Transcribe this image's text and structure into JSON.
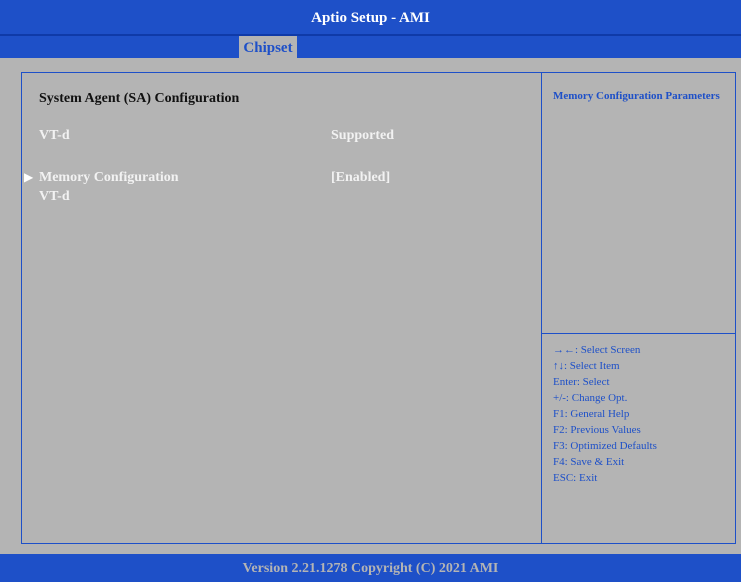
{
  "header": {
    "title": "Aptio Setup - AMI"
  },
  "tabs": [
    {
      "label": "Chipset",
      "active": true
    }
  ],
  "main": {
    "title": "System Agent (SA) Configuration",
    "rows": [
      {
        "label": "VT-d",
        "value": "Supported"
      },
      {
        "label": "Memory Configuration",
        "value": "[Enabled]",
        "submenu": true,
        "selected": true
      },
      {
        "label": "VT-d",
        "value": ""
      }
    ]
  },
  "help": {
    "text": "Memory Configuration Parameters"
  },
  "keys": [
    "→←: Select Screen",
    "↑↓: Select Item",
    "Enter: Select",
    "+/-: Change Opt.",
    "F1: General Help",
    "F2: Previous Values",
    "F3: Optimized Defaults",
    "F4: Save & Exit",
    "ESC: Exit"
  ],
  "footer": {
    "text": "Version 2.21.1278 Copyright (C) 2021 AMI"
  },
  "colors": {
    "blue": "#1e50c8",
    "gray": "#b4b4b4",
    "white": "#ffffff"
  },
  "icons": {
    "submenu_arrow": "triangle-right-icon"
  }
}
